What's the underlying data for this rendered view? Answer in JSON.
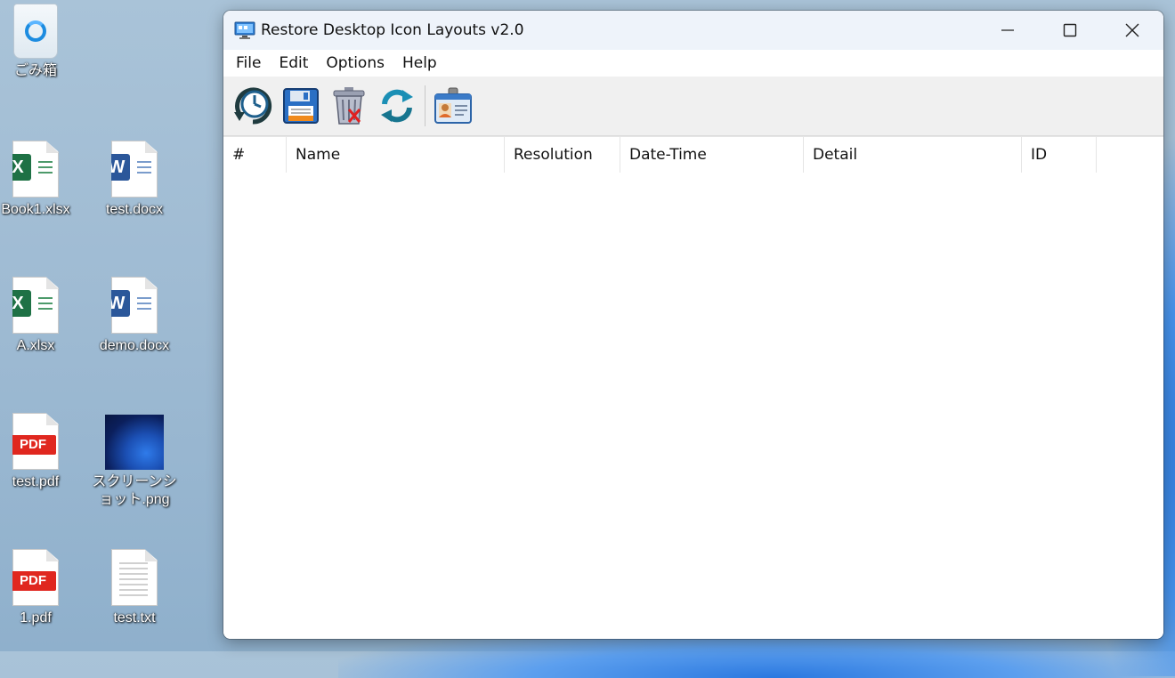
{
  "desktop": {
    "icons": [
      {
        "label": "ごみ箱",
        "type": "recycle-bin"
      },
      {
        "label": "Book1.xlsx",
        "type": "excel"
      },
      {
        "label": "test.docx",
        "type": "word"
      },
      {
        "label": "A.xlsx",
        "type": "excel"
      },
      {
        "label": "demo.docx",
        "type": "word"
      },
      {
        "label": "test.pdf",
        "type": "pdf"
      },
      {
        "label": "スクリーンショット.png",
        "type": "image"
      },
      {
        "label": "1.pdf",
        "type": "pdf"
      },
      {
        "label": "test.txt",
        "type": "text"
      }
    ],
    "badges": {
      "excel": "X",
      "word": "W",
      "pdf": "PDF"
    }
  },
  "window": {
    "title": "Restore Desktop Icon Layouts v2.0",
    "menu": [
      "File",
      "Edit",
      "Options",
      "Help"
    ],
    "toolbar": [
      "restore-clock-icon",
      "save-floppy-icon",
      "delete-trash-icon",
      "refresh-icon",
      "id-card-icon"
    ],
    "columns": [
      "#",
      "Name",
      "Resolution",
      "Date-Time",
      "Detail",
      "ID"
    ]
  },
  "colors": {
    "excel": "#1e7145",
    "word": "#2b579a",
    "pdf": "#e0271f",
    "titlebar": "#eef3fa"
  }
}
